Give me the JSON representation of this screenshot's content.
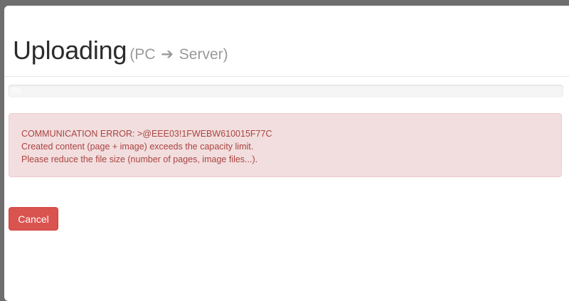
{
  "dialog": {
    "title": "Uploading",
    "subtitle_from": "(PC",
    "subtitle_arrow": "➔",
    "subtitle_to": "Server)"
  },
  "progress": {
    "value_percent": 0,
    "label": "0%",
    "fill_color": "#337ab7"
  },
  "alert": {
    "lines": [
      "COMMUNICATION ERROR: >@EEE03!1FWEBW610015F77C",
      "Created content (page + image) exceeds the capacity limit.",
      "Please reduce the file size (number of pages, image files...)."
    ],
    "background_color": "#f2dede",
    "text_color": "#a94442"
  },
  "actions": {
    "cancel_label": "Cancel",
    "cancel_color": "#d9534f"
  }
}
